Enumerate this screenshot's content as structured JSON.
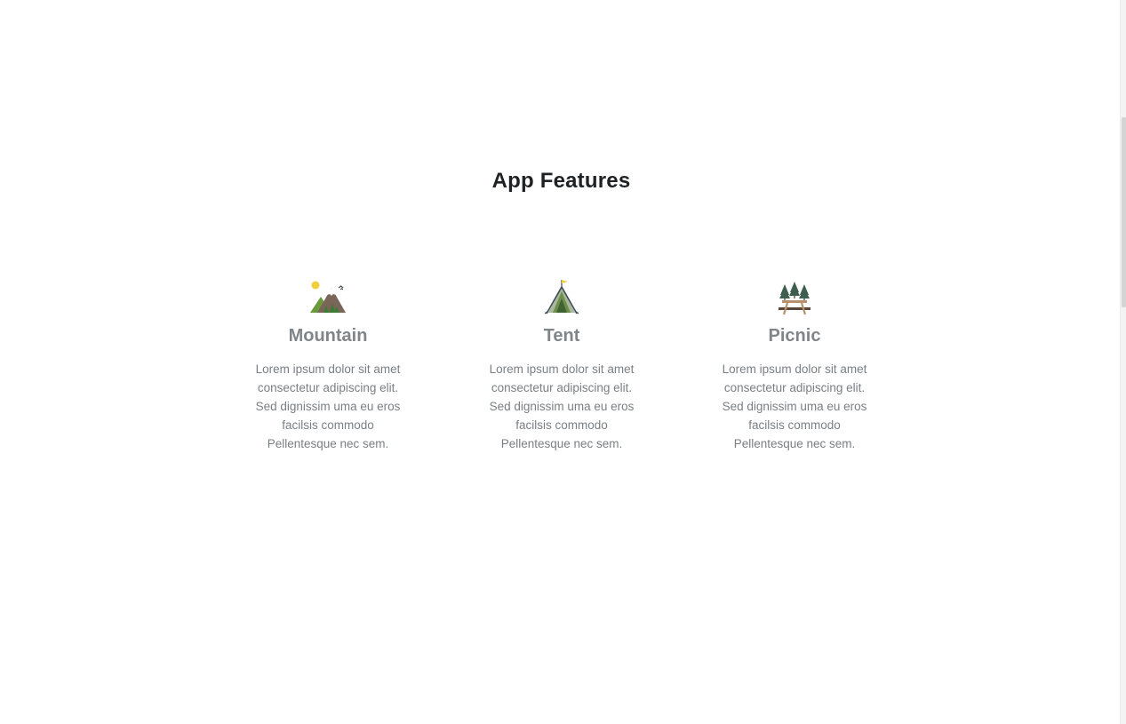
{
  "section": {
    "title": "App Features"
  },
  "features": [
    {
      "icon": "mountain-icon",
      "title": "Mountain",
      "description": "Lorem ipsum dolor sit amet consectetur adipiscing elit. Sed dignissim uma eu eros facilsis commodo Pellentesque nec sem."
    },
    {
      "icon": "tent-icon",
      "title": "Tent",
      "description": "Lorem ipsum dolor sit amet consectetur adipiscing elit. Sed dignissim uma eu eros facilsis commodo Pellentesque nec sem."
    },
    {
      "icon": "picnic-icon",
      "title": "Picnic",
      "description": "Lorem ipsum dolor sit amet consectetur adipiscing elit. Sed dignissim uma eu eros facilsis commodo Pellentesque nec sem."
    }
  ],
  "colors": {
    "title": "#1f2224",
    "feature_title": "#80858a",
    "body_text": "#7a7f84"
  }
}
